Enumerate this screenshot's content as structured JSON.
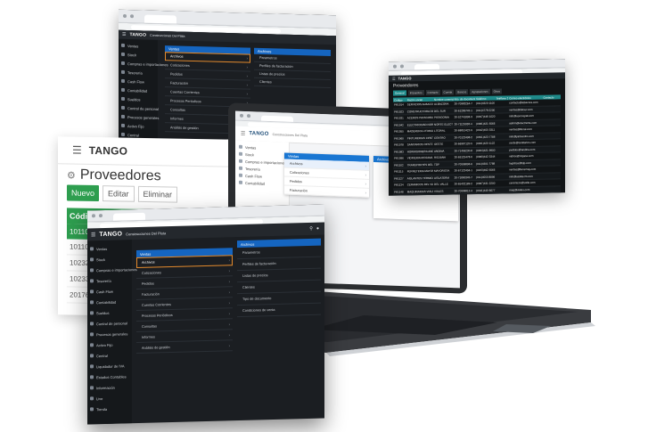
{
  "brand": {
    "logo": "TANGO",
    "company": "Construcciones Del Plata"
  },
  "sidebar_items": [
    "Ventas",
    "Stock",
    "Compras e importaciones",
    "Tesorería",
    "Cash Flow",
    "Contabilidad",
    "Sueldos",
    "Control de personal",
    "Procesos generales",
    "Activo Fijo",
    "Central",
    "Liquidador de IVA",
    "Estados Contables",
    "Información",
    "Live",
    "Tienda"
  ],
  "menu": {
    "header": "Ventas",
    "items": [
      "Archivos",
      "Cotizaciones",
      "Pedidos",
      "Facturación",
      "Cuentas Corrientes",
      "Procesos Periódicos",
      "Consultas",
      "Informes",
      "Análisis de gestión"
    ]
  },
  "submenu": {
    "header": "Archivos",
    "items": [
      "Parametros",
      "Perfiles de facturación",
      "Listas de precios",
      "Clientes",
      "Tipo de documento",
      "Condiciones de venta"
    ]
  },
  "providers_window": {
    "title": "Proveedores",
    "buttons": {
      "new": "Nuevo",
      "edit": "Editar",
      "delete": "Eliminar"
    },
    "column_header": "Código",
    "codes": [
      "101101",
      "101107",
      "102321",
      "102332",
      "201764"
    ]
  },
  "grid_window": {
    "title": "Proveedores",
    "tabs": [
      "General",
      "Impuestos",
      "Contacto",
      "Cuenta",
      "Bancos",
      "Agrupaciones",
      "Otros"
    ],
    "columns": [
      "Código",
      "Razón social",
      "Nombre comercial",
      "Nro. de documento",
      "Teléfono",
      "Teléfono 2",
      "Correo electrónico",
      "Contacto"
    ],
    "rows": [
      [
        "PR1014",
        "SERVICIOS ALBACORA",
        "ALBACORA",
        "30-70983264-7",
        "(011)4320-1100",
        "",
        "contacto@albacora.com",
        ""
      ],
      [
        "PR1023",
        "CONSTRUCTORA DEL SUR",
        "DEL SUR",
        "30-61289745-1",
        "(011)4778-2200",
        "",
        "ventas@delsur.com",
        ""
      ],
      [
        "PR1031",
        "ACEROS PATAGONIA",
        "PATAGONIA",
        "30-52741896-3",
        "(0297)446-1020",
        "",
        "info@acerospat.com",
        ""
      ],
      [
        "PR1042",
        "ELECTRICIDAD NORTE",
        "NORTE ELECT",
        "30-71129038-4",
        "(0381)421-5566",
        "",
        "admin@electnorte.com",
        ""
      ],
      [
        "PR1055",
        "MADERERA LITORAL",
        "LITORAL",
        "30-68810422-9",
        "(0342)455-3311",
        "",
        "ventas@litoral.com",
        ""
      ],
      [
        "PR1060",
        "PINTURERIAS CENTRO",
        "CENTRO",
        "30-70123498-2",
        "(0351)423-7788",
        "",
        "info@pintcentro.com",
        ""
      ],
      [
        "PR1078",
        "SANITARIOS OESTE",
        "OESTE",
        "30-66987120-5",
        "(0261)420-1122",
        "",
        "oeste@sanitarios.com",
        ""
      ],
      [
        "PR1083",
        "HORMIGONERA ANDINA",
        "ANDINA",
        "30-71456230-8",
        "(0264)421-9900",
        "",
        "pedidos@andina.com",
        ""
      ],
      [
        "PR1096",
        "VIDRIERIA RIOJANA",
        "RIOJANA",
        "30-69125478-0",
        "(0380)442-3344",
        "",
        "vidrios@riojana.com",
        ""
      ],
      [
        "PR1102",
        "TRANSPORTES DEL PLATA",
        "TDP",
        "30-70558896-6",
        "(011)4301-7788",
        "",
        "logistica@tdp.com",
        ""
      ],
      [
        "PR1115",
        "FERRETERIA MAYORISTA",
        "MAYORISTA",
        "30-67123456-1",
        "(0223)492-5566",
        "",
        "ventas@ferremay.com",
        ""
      ],
      [
        "PR1127",
        "AISLANTES TERMICOS",
        "AISLATERM",
        "30-71890345-7",
        "(011)4555-8899",
        "",
        "info@aislaterm.com",
        ""
      ],
      [
        "PR1134",
        "CERAMICOS DEL VALLE",
        "DEL VALLE",
        "30-65432189-2",
        "(0387)431-2200",
        "",
        "ceramicos@valle.com",
        ""
      ],
      [
        "PR1148",
        "MAQUINARIAS VIALES",
        "VIALES",
        "30-70998812-4",
        "(0341)440-6677",
        "",
        "maq@viales.com",
        ""
      ]
    ]
  },
  "light_window": {
    "panel_header": "Ventas",
    "items": [
      "Archivos",
      "Cotizaciones",
      "Pedidos",
      "Facturación"
    ],
    "side_header": "Archivos"
  }
}
